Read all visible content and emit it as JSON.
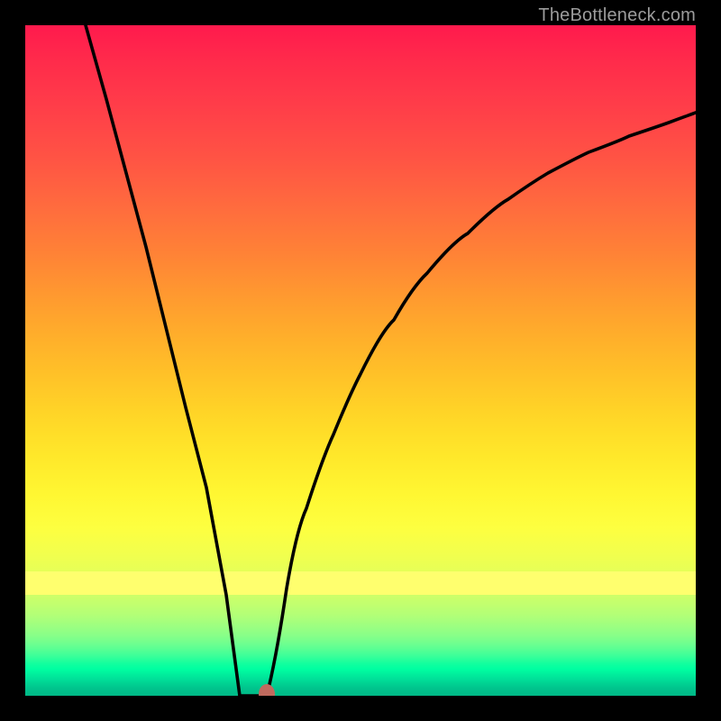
{
  "watermark": {
    "text": "TheBottleneck.com"
  },
  "colors": {
    "frame": "#000000",
    "curve": "#000000",
    "marker": "#c06a5e",
    "gradient_top": "#ff1a4d",
    "gradient_bottom": "#00b886"
  },
  "chart_data": {
    "type": "line",
    "title": "",
    "xlabel": "",
    "ylabel": "",
    "xlim": [
      0,
      100
    ],
    "ylim": [
      0,
      100
    ],
    "marker": {
      "x": 36,
      "y": 0
    },
    "flat_bottom": {
      "x_start": 32,
      "x_end": 36,
      "y": 0
    },
    "series": [
      {
        "name": "left-branch",
        "x": [
          9,
          12,
          15,
          18,
          21,
          24,
          27,
          30,
          32
        ],
        "values": [
          100,
          89,
          78,
          67,
          55,
          43,
          31,
          15,
          0
        ]
      },
      {
        "name": "right-branch",
        "x": [
          36,
          39,
          42,
          46,
          50,
          55,
          60,
          66,
          72,
          78,
          84,
          90,
          96,
          100
        ],
        "values": [
          0,
          16,
          28,
          39,
          48,
          56,
          63,
          69,
          74,
          78,
          81,
          83.5,
          85.5,
          87
        ]
      }
    ],
    "grid": false,
    "legend": false,
    "ticks": {
      "x": [],
      "y": []
    }
  }
}
